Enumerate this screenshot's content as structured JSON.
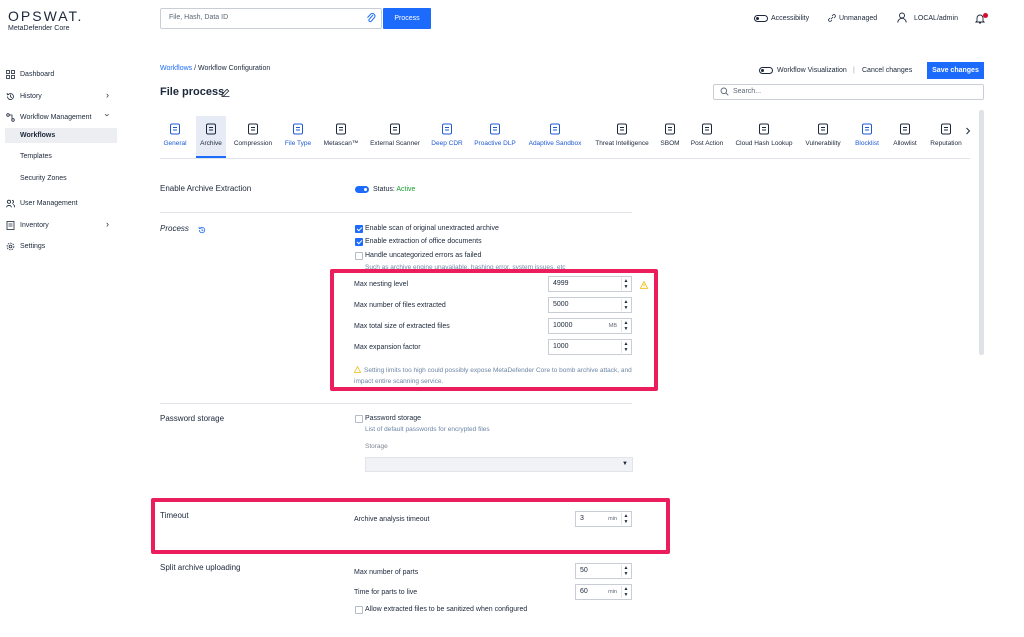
{
  "header": {
    "logo": "OPSWAT.",
    "product": "MetaDefender Core",
    "search_placeholder": "File, Hash, Data ID",
    "process_label": "Process",
    "accessibility_label": "Accessibility",
    "unmanaged_label": "Unmanaged",
    "user_label": "LOCAL/admin"
  },
  "sidebar": {
    "items": [
      {
        "label": "Dashboard",
        "icon": "dashboard-icon"
      },
      {
        "label": "History",
        "icon": "history-icon"
      },
      {
        "label": "Workflow Management",
        "icon": "workflow-icon"
      },
      {
        "label": "User Management",
        "icon": "users-icon"
      },
      {
        "label": "Inventory",
        "icon": "inventory-icon"
      },
      {
        "label": "Settings",
        "icon": "gear-icon"
      }
    ],
    "subitems": [
      "Workflows",
      "Templates",
      "Security Zones"
    ]
  },
  "breadcrumb": {
    "root": "Workflows",
    "sep": " / ",
    "current": "Workflow Configuration"
  },
  "page_title": "File process",
  "toolbar": {
    "workflow_visualization": "Workflow Visualization",
    "divider": "|",
    "cancel": "Cancel changes",
    "save": "Save changes",
    "search_placeholder": "Search..."
  },
  "tabs": [
    {
      "label": "General",
      "blue": true
    },
    {
      "label": "Archive",
      "blue": false
    },
    {
      "label": "Compression",
      "blue": false
    },
    {
      "label": "File Type",
      "blue": true
    },
    {
      "label": "Metascan™",
      "blue": false
    },
    {
      "label": "External Scanner",
      "blue": false
    },
    {
      "label": "Deep CDR",
      "blue": true
    },
    {
      "label": "Proactive DLP",
      "blue": true
    },
    {
      "label": "Adaptive Sandbox",
      "blue": true
    },
    {
      "label": "Threat Intelligence",
      "blue": false
    },
    {
      "label": "SBOM",
      "blue": false
    },
    {
      "label": "Post Action",
      "blue": false
    },
    {
      "label": "Cloud Hash Lookup",
      "blue": false
    },
    {
      "label": "Vulnerability",
      "blue": false
    },
    {
      "label": "Blocklist",
      "blue": true
    },
    {
      "label": "Allowlist",
      "blue": false
    },
    {
      "label": "Reputation",
      "blue": false
    }
  ],
  "enable_archive": {
    "label": "Enable Archive Extraction",
    "status_prefix": "Status:",
    "status": "Active"
  },
  "process": {
    "label": "Process",
    "checkboxes": [
      {
        "label": "Enable scan of original unextracted archive",
        "checked": true
      },
      {
        "label": "Enable extraction of office documents",
        "checked": true
      },
      {
        "label": "Handle uncategorized errors as failed",
        "checked": false
      }
    ],
    "hint": "Such as archive engine unavailable, hashing error, system issues, etc",
    "fields": [
      {
        "label": "Max nesting level",
        "value": "4999",
        "unit": ""
      },
      {
        "label": "Max number of files extracted",
        "value": "5000",
        "unit": ""
      },
      {
        "label": "Max total size of extracted files",
        "value": "10000",
        "unit": "MB"
      },
      {
        "label": "Max expansion factor",
        "value": "1000",
        "unit": ""
      }
    ],
    "warning": "Setting limits too high could possibly expose MetaDefender Core to bomb archive attack, and impact entire scanning service."
  },
  "password": {
    "label": "Password storage",
    "checkbox": "Password storage",
    "hint": "List of default passwords for encrypted files",
    "storage_label": "Storage"
  },
  "timeout": {
    "label": "Timeout",
    "field": "Archive analysis timeout",
    "value": "3",
    "unit": "min"
  },
  "split": {
    "label": "Split archive uploading",
    "fields": [
      {
        "label": "Max number of parts",
        "value": "50",
        "unit": ""
      },
      {
        "label": "Time for parts to live",
        "value": "60",
        "unit": "min"
      }
    ],
    "checkbox": "Allow extracted files to be sanitized when configured"
  },
  "colors": {
    "accent": "#1d6bfc",
    "highlight": "#ec1d5d",
    "active_status": "#1a9d2e",
    "warning": "#f2b705"
  }
}
